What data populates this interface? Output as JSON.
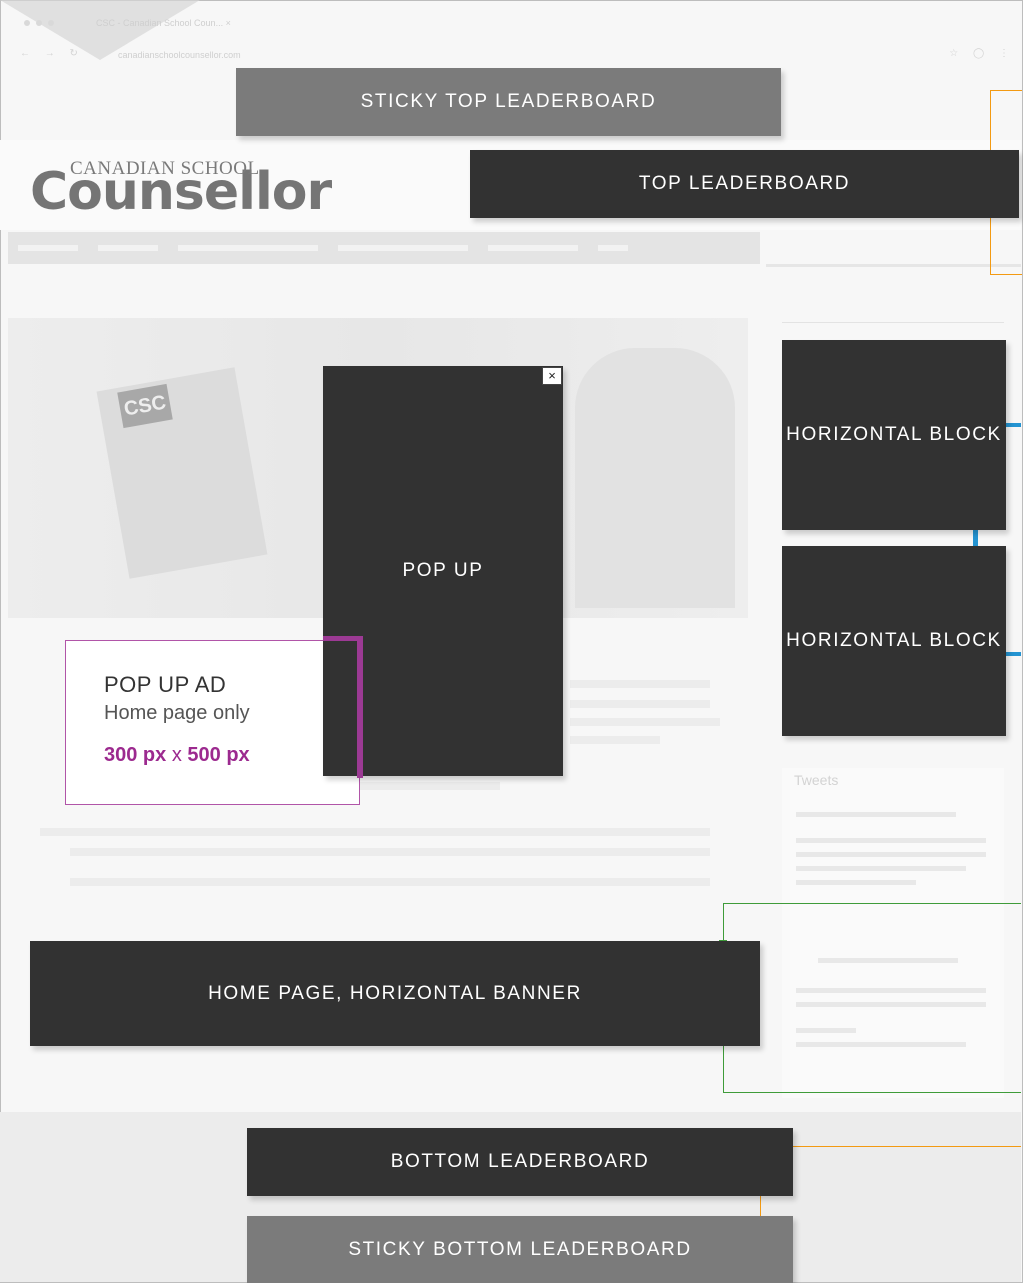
{
  "browser": {
    "tab_title": "CSC - Canadian School Coun... ×",
    "address": "canadianschoolcounsellor.com"
  },
  "site": {
    "logo_small": "CANADIAN SCHOOL",
    "logo_big": "Counsellor"
  },
  "hero": {
    "mag_label": "CSC"
  },
  "sidebar": {
    "tweets_title": "Tweets"
  },
  "ads": {
    "sticky_top": "STICKY TOP LEADERBOARD",
    "top": "TOP LEADERBOARD",
    "horizontal_block_1": "HORIZONTAL BLOCK",
    "horizontal_block_2": "HORIZONTAL BLOCK",
    "popup": "POP UP",
    "popup_close": "×",
    "home_banner": "HOME PAGE, HORIZONTAL BANNER",
    "bottom": "BOTTOM LEADERBOARD",
    "sticky_bottom": "STICKY BOTTOM LEADERBOARD"
  },
  "callout": {
    "title": "POP UP AD",
    "subtitle": "Home page only",
    "width_value": "300 px",
    "times": "x",
    "height_value": "500 px"
  },
  "colors": {
    "ad_dark": "#323232",
    "ad_grey": "#7b7b7b",
    "orange": "#f39a12",
    "blue": "#2494d2",
    "green": "#3f9c3a",
    "purple": "#9c3a94"
  }
}
